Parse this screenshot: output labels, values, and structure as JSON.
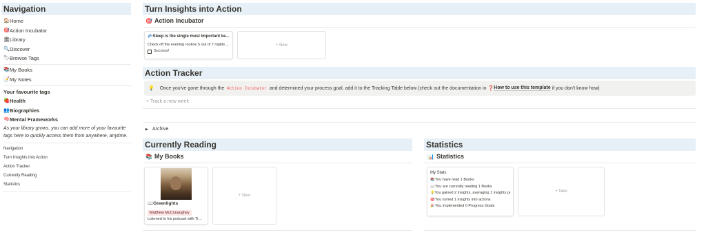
{
  "sidebar": {
    "title": "Navigation",
    "items": [
      {
        "icon": "🏠",
        "label": "Home"
      },
      {
        "icon": "🎯",
        "label": "Action Incubator"
      },
      {
        "icon": "🏛",
        "label": "Library"
      },
      {
        "icon": "🔍",
        "label": "Discover"
      },
      {
        "icon": "🏷",
        "label": "Browse Tags"
      }
    ],
    "items2": [
      {
        "icon": "📚",
        "label": "My Books"
      },
      {
        "icon": "📝",
        "label": "My Notes"
      }
    ],
    "fav_title": "Your favourite tags",
    "fav_tags": [
      {
        "icon": "🍓",
        "label": "Health"
      },
      {
        "icon": "👥",
        "label": "Biographies"
      },
      {
        "icon": "🧠",
        "label": "Mental Frameworks"
      }
    ],
    "note": "As your library grows, you can add more of your favourite tags here to quickly access them from anywhere, anytime.",
    "toc": [
      "Navigation",
      "Turn Insights into Action",
      "Action Tracker",
      "Currently Reading",
      "Statistics"
    ]
  },
  "insights": {
    "title": "Turn Insights into Action",
    "sub": "Action Incubator",
    "card": {
      "title": "Sleep is the single most important ke...",
      "desc": "Check off the evening routine 5 out of 7 nights ...",
      "check": "Success!"
    },
    "new": "+ New"
  },
  "tracker": {
    "title": "Action Tracker",
    "callout_pre": "Once you've gone through the",
    "callout_code": "Action Incubator",
    "callout_mid": "and determined your process goal, add it to the Tracking Table below (check out the documentation in",
    "callout_link": "How to use this template",
    "callout_post": "if you don't know how)",
    "track_new": "+ Track a new week",
    "archive": "Archive"
  },
  "reading": {
    "title": "Currently Reading",
    "sub": "My Books",
    "book": {
      "title": "Greenlights",
      "author": "Matthew McConaughey",
      "note": "Listened to his podcast with Tim ..."
    },
    "new": "+ New"
  },
  "stats": {
    "title": "Statistics",
    "sub": "Statistics",
    "card_title": "My Stats",
    "lines": [
      {
        "icon": "📚",
        "text": "You have read 1 Books"
      },
      {
        "icon": "📖",
        "text": "You are currently reading 1 Books"
      },
      {
        "icon": "💡",
        "text": "You gained 2 insights, averaging 1 insights pe..."
      },
      {
        "icon": "🎯",
        "text": "You turned 1 insights into actions"
      },
      {
        "icon": "🎉",
        "text": "You implemented 0 Progress Goals"
      }
    ],
    "new": "+ New"
  }
}
